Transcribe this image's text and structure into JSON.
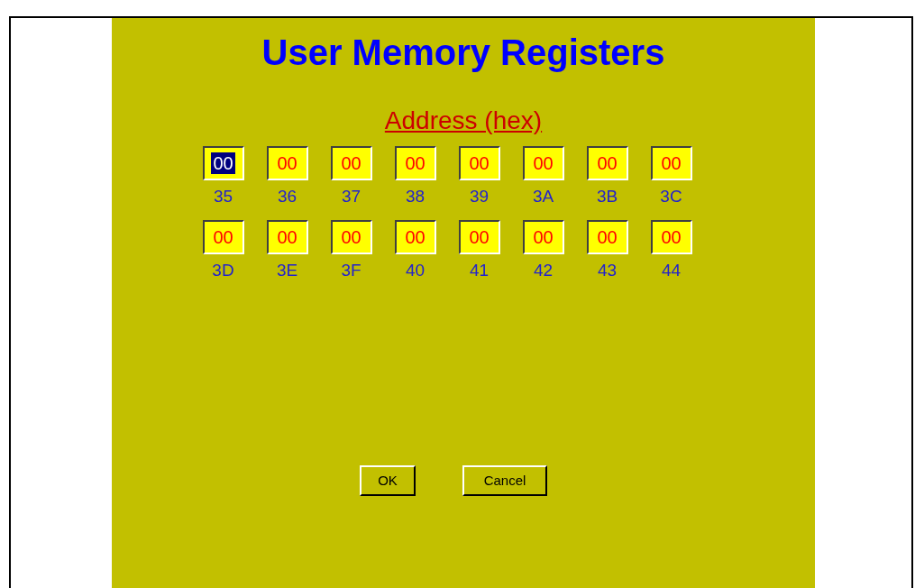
{
  "dialog": {
    "title": "User Memory Registers",
    "subtitle": "Address (hex)",
    "registers": [
      {
        "value": "00",
        "address": "35",
        "selected": true
      },
      {
        "value": "00",
        "address": "36",
        "selected": false
      },
      {
        "value": "00",
        "address": "37",
        "selected": false
      },
      {
        "value": "00",
        "address": "38",
        "selected": false
      },
      {
        "value": "00",
        "address": "39",
        "selected": false
      },
      {
        "value": "00",
        "address": "3A",
        "selected": false
      },
      {
        "value": "00",
        "address": "3B",
        "selected": false
      },
      {
        "value": "00",
        "address": "3C",
        "selected": false
      },
      {
        "value": "00",
        "address": "3D",
        "selected": false
      },
      {
        "value": "00",
        "address": "3E",
        "selected": false
      },
      {
        "value": "00",
        "address": "3F",
        "selected": false
      },
      {
        "value": "00",
        "address": "40",
        "selected": false
      },
      {
        "value": "00",
        "address": "41",
        "selected": false
      },
      {
        "value": "00",
        "address": "42",
        "selected": false
      },
      {
        "value": "00",
        "address": "43",
        "selected": false
      },
      {
        "value": "00",
        "address": "44",
        "selected": false
      }
    ],
    "buttons": [
      "OK",
      "Cancel"
    ]
  }
}
